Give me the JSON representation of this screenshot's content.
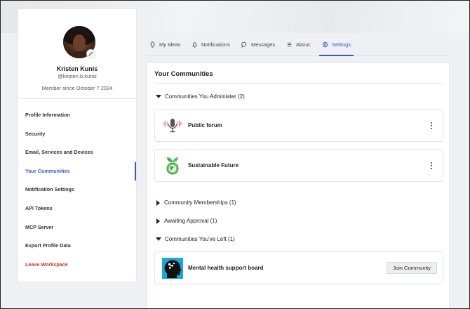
{
  "profile": {
    "name": "Kristen Kunis",
    "handle": "@kristen.b.kunis",
    "member_since": "Member since October 7 2024"
  },
  "sidebar": {
    "items": [
      {
        "label": "Profile Information"
      },
      {
        "label": "Security"
      },
      {
        "label": "Email, Services and Devices"
      },
      {
        "label": "Your Communities",
        "active": true
      },
      {
        "label": "Notification Settings"
      },
      {
        "label": "API Tokens"
      },
      {
        "label": "MCP Server"
      },
      {
        "label": "Export Profile Data"
      },
      {
        "label": "Leave Workspace",
        "danger": true
      }
    ]
  },
  "tabs": [
    {
      "label": "My Ideas",
      "icon": "lightbulb-icon"
    },
    {
      "label": "Notifications",
      "icon": "bell-icon"
    },
    {
      "label": "Messages",
      "icon": "chat-bubble-icon"
    },
    {
      "label": "About.",
      "icon": "list-icon"
    },
    {
      "label": "Settings",
      "icon": "gear-icon",
      "active": true
    }
  ],
  "main": {
    "title": "Your Communities",
    "administer": {
      "label": "Communities You Administer (2)",
      "communities": [
        {
          "name": "Public forum",
          "icon": "microphone-icon"
        },
        {
          "name": "Sustainable Future",
          "icon": "globe-leaf-icon"
        }
      ]
    },
    "memberships": {
      "label": "Community Memberships (1)"
    },
    "awaiting": {
      "label": "Awaiting Approval (1)"
    },
    "left": {
      "label": "Communities You've Left (1)",
      "communities": [
        {
          "name": "Mental health support board",
          "icon": "head-puzzle-icon",
          "action": "Join Community"
        }
      ]
    }
  },
  "colors": {
    "accent": "#3b58c4",
    "danger": "#c0392b"
  }
}
